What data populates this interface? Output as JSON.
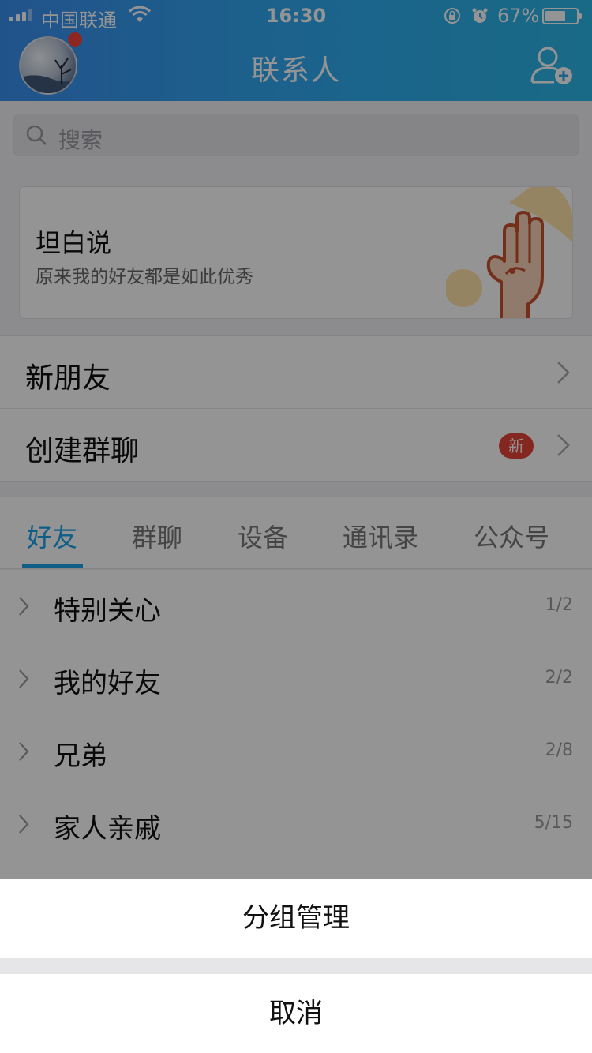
{
  "status_bar": {
    "carrier": "中国联通",
    "time": "16:30",
    "battery": "67%",
    "battery_level": 0.67
  },
  "header": {
    "title": "联系人",
    "avatar_has_notification": true
  },
  "search": {
    "placeholder": "搜索"
  },
  "banner": {
    "title": "坦白说",
    "subtitle": "原来我的好友都是如此优秀"
  },
  "rows": {
    "new_friends": "新朋友",
    "create_group_chat": "创建群聊",
    "new_badge": "新"
  },
  "tabs": [
    {
      "label": "好友",
      "active": true
    },
    {
      "label": "群聊",
      "active": false
    },
    {
      "label": "设备",
      "active": false
    },
    {
      "label": "通讯录",
      "active": false
    },
    {
      "label": "公众号",
      "active": false
    }
  ],
  "groups": [
    {
      "name": "特别关心",
      "count": "1/2"
    },
    {
      "name": "我的好友",
      "count": "2/2"
    },
    {
      "name": "兄弟",
      "count": "2/8"
    },
    {
      "name": "家人亲戚",
      "count": "5/15"
    }
  ],
  "action_sheet": {
    "manage_groups": "分组管理",
    "cancel": "取消"
  },
  "colors": {
    "header_start": "#3a8ff0",
    "header_end": "#2bb7e8",
    "accent": "#1aa3e8",
    "badge": "#e5443a",
    "hand_stroke": "#c8512e"
  }
}
